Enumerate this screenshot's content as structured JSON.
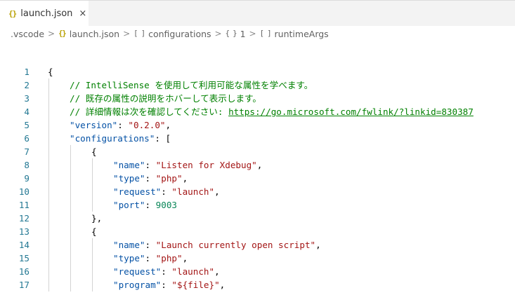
{
  "tab": {
    "icon": "{}",
    "label": "launch.json",
    "close": "×"
  },
  "breadcrumb": [
    {
      "label": ".vscode",
      "icon": ""
    },
    {
      "label": "launch.json",
      "icon": "{}"
    },
    {
      "label": "configurations",
      "icon": "[ ]"
    },
    {
      "label": "1",
      "icon": "{ }"
    },
    {
      "label": "runtimeArgs",
      "icon": "[ ]"
    }
  ],
  "breadcrumb_separator": ">",
  "editor": {
    "lines": [
      {
        "n": "1",
        "indent": 0,
        "tokens": [
          {
            "t": "p",
            "v": "{"
          }
        ]
      },
      {
        "n": "2",
        "indent": 1,
        "tokens": [
          {
            "t": "c",
            "v": "// IntelliSense を使用して利用可能な属性を学べます。"
          }
        ]
      },
      {
        "n": "3",
        "indent": 1,
        "tokens": [
          {
            "t": "c",
            "v": "// 既存の属性の説明をホバーして表示します。"
          }
        ]
      },
      {
        "n": "4",
        "indent": 1,
        "tokens": [
          {
            "t": "c",
            "v": "// 詳細情報は次を確認してください: "
          },
          {
            "t": "l",
            "v": "https://go.microsoft.com/fwlink/?linkid=830387"
          }
        ]
      },
      {
        "n": "5",
        "indent": 1,
        "tokens": [
          {
            "t": "k",
            "v": "\"version\""
          },
          {
            "t": "p",
            "v": ": "
          },
          {
            "t": "s",
            "v": "\"0.2.0\""
          },
          {
            "t": "p",
            "v": ","
          }
        ]
      },
      {
        "n": "6",
        "indent": 1,
        "tokens": [
          {
            "t": "k",
            "v": "\"configurations\""
          },
          {
            "t": "p",
            "v": ": ["
          }
        ]
      },
      {
        "n": "7",
        "indent": 2,
        "tokens": [
          {
            "t": "p",
            "v": "{"
          }
        ]
      },
      {
        "n": "8",
        "indent": 3,
        "tokens": [
          {
            "t": "k",
            "v": "\"name\""
          },
          {
            "t": "p",
            "v": ": "
          },
          {
            "t": "s",
            "v": "\"Listen for Xdebug\""
          },
          {
            "t": "p",
            "v": ","
          }
        ]
      },
      {
        "n": "9",
        "indent": 3,
        "tokens": [
          {
            "t": "k",
            "v": "\"type\""
          },
          {
            "t": "p",
            "v": ": "
          },
          {
            "t": "s",
            "v": "\"php\""
          },
          {
            "t": "p",
            "v": ","
          }
        ]
      },
      {
        "n": "10",
        "indent": 3,
        "tokens": [
          {
            "t": "k",
            "v": "\"request\""
          },
          {
            "t": "p",
            "v": ": "
          },
          {
            "t": "s",
            "v": "\"launch\""
          },
          {
            "t": "p",
            "v": ","
          }
        ]
      },
      {
        "n": "11",
        "indent": 3,
        "tokens": [
          {
            "t": "k",
            "v": "\"port\""
          },
          {
            "t": "p",
            "v": ": "
          },
          {
            "t": "n",
            "v": "9003"
          }
        ]
      },
      {
        "n": "12",
        "indent": 2,
        "tokens": [
          {
            "t": "p",
            "v": "},"
          }
        ]
      },
      {
        "n": "13",
        "indent": 2,
        "tokens": [
          {
            "t": "p",
            "v": "{"
          }
        ]
      },
      {
        "n": "14",
        "indent": 3,
        "tokens": [
          {
            "t": "k",
            "v": "\"name\""
          },
          {
            "t": "p",
            "v": ": "
          },
          {
            "t": "s",
            "v": "\"Launch currently open script\""
          },
          {
            "t": "p",
            "v": ","
          }
        ]
      },
      {
        "n": "15",
        "indent": 3,
        "tokens": [
          {
            "t": "k",
            "v": "\"type\""
          },
          {
            "t": "p",
            "v": ": "
          },
          {
            "t": "s",
            "v": "\"php\""
          },
          {
            "t": "p",
            "v": ","
          }
        ]
      },
      {
        "n": "16",
        "indent": 3,
        "tokens": [
          {
            "t": "k",
            "v": "\"request\""
          },
          {
            "t": "p",
            "v": ": "
          },
          {
            "t": "s",
            "v": "\"launch\""
          },
          {
            "t": "p",
            "v": ","
          }
        ]
      },
      {
        "n": "17",
        "indent": 3,
        "tokens": [
          {
            "t": "k",
            "v": "\"program\""
          },
          {
            "t": "p",
            "v": ": "
          },
          {
            "t": "s",
            "v": "\"${file}\""
          },
          {
            "t": "p",
            "v": ","
          }
        ]
      }
    ]
  },
  "colors": {
    "line_number": "#237893",
    "comment": "#008000",
    "key": "#0451a5",
    "string": "#a31515",
    "number": "#098658",
    "json_icon": "#b8a000"
  }
}
